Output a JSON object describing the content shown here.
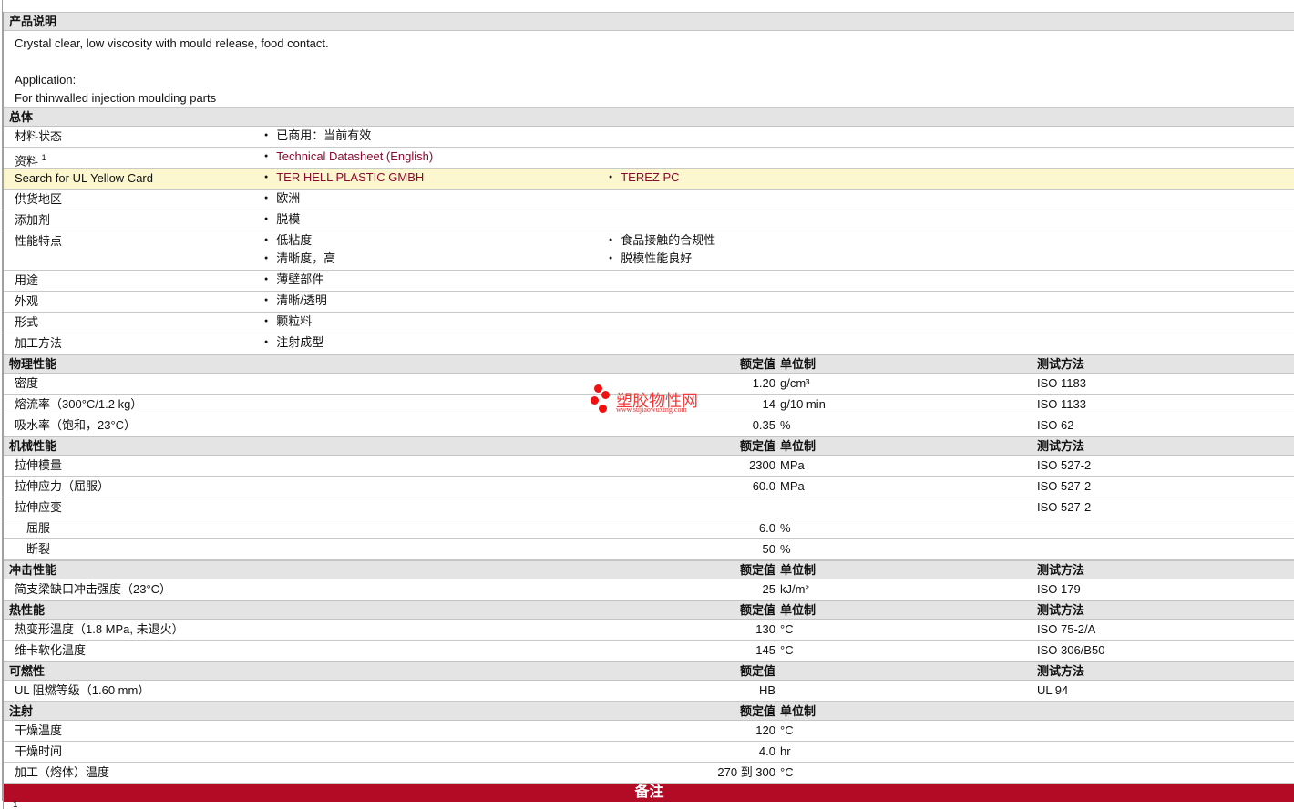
{
  "description": {
    "title": "产品说明",
    "lines": [
      "Crystal clear, low viscosity with mould release, food contact.",
      "",
      "Application:",
      "For thinwalled injection moulding parts"
    ]
  },
  "general": {
    "title": "总体",
    "rows": [
      {
        "label": "材料状态",
        "col1": [
          "已商用：当前有效"
        ],
        "col2": []
      },
      {
        "label": "资料",
        "sup": "1",
        "col1": [
          "Technical Datasheet (English)"
        ],
        "col2": [],
        "link": true
      },
      {
        "label": "Search for UL Yellow Card",
        "col1": [
          "TER HELL PLASTIC GMBH"
        ],
        "col2": [
          "TEREZ PC"
        ],
        "link": true,
        "highlight": true
      },
      {
        "label": "供货地区",
        "col1": [
          "欧洲"
        ],
        "col2": []
      },
      {
        "label": "添加剂",
        "col1": [
          "脱模"
        ],
        "col2": []
      },
      {
        "label": "性能特点",
        "col1": [
          "低粘度",
          "清晰度，高"
        ],
        "col2": [
          "食品接触的合规性",
          "脱模性能良好"
        ]
      },
      {
        "label": "用途",
        "col1": [
          "薄壁部件"
        ],
        "col2": []
      },
      {
        "label": "外观",
        "col1": [
          "清晰/透明"
        ],
        "col2": []
      },
      {
        "label": "形式",
        "col1": [
          "颗粒料"
        ],
        "col2": []
      },
      {
        "label": "加工方法",
        "col1": [
          "注射成型"
        ],
        "col2": []
      }
    ]
  },
  "sections": [
    {
      "title": "物理性能",
      "hv": "额定值",
      "hu": "单位制",
      "hm": "测试方法",
      "rows": [
        {
          "label": "密度",
          "value": "1.20",
          "unit": "g/cm³",
          "method": "ISO 1183"
        },
        {
          "label": "熔流率（300°C/1.2 kg）",
          "value": "14",
          "unit": "g/10 min",
          "method": "ISO 1133"
        },
        {
          "label": "吸水率（饱和，23°C）",
          "value": "0.35",
          "unit": "%",
          "method": "ISO 62"
        }
      ]
    },
    {
      "title": "机械性能",
      "hv": "额定值",
      "hu": "单位制",
      "hm": "测试方法",
      "rows": [
        {
          "label": "拉伸模量",
          "value": "2300",
          "unit": "MPa",
          "method": "ISO 527-2"
        },
        {
          "label": "拉伸应力（屈服）",
          "value": "60.0",
          "unit": "MPa",
          "method": "ISO 527-2"
        },
        {
          "label": "拉伸应变",
          "value": "",
          "unit": "",
          "method": "ISO 527-2"
        },
        {
          "label": "屈服",
          "value": "6.0",
          "unit": "%",
          "method": "",
          "sub": true
        },
        {
          "label": "断裂",
          "value": "50",
          "unit": "%",
          "method": "",
          "sub": true
        }
      ]
    },
    {
      "title": "冲击性能",
      "hv": "额定值",
      "hu": "单位制",
      "hm": "测试方法",
      "rows": [
        {
          "label": "简支梁缺口冲击强度（23°C）",
          "value": "25",
          "unit": "kJ/m²",
          "method": "ISO 179"
        }
      ]
    },
    {
      "title": "热性能",
      "hv": "额定值",
      "hu": "单位制",
      "hm": "测试方法",
      "rows": [
        {
          "label": "热变形温度（1.8 MPa, 未退火）",
          "value": "130",
          "unit": "°C",
          "method": "ISO 75-2/A"
        },
        {
          "label": "维卡软化温度",
          "value": "145",
          "unit": "°C",
          "method": "ISO 306/B50"
        }
      ]
    },
    {
      "title": "可燃性",
      "hv": "额定值",
      "hu": "",
      "hm": "测试方法",
      "rows": [
        {
          "label": "UL 阻燃等级（1.60 mm）",
          "value": "HB",
          "unit": "",
          "method": "UL 94"
        }
      ]
    },
    {
      "title": "注射",
      "hv": "额定值",
      "hu": "单位制",
      "hm": "",
      "rows": [
        {
          "label": "干燥温度",
          "value": "120",
          "unit": "°C",
          "method": ""
        },
        {
          "label": "干燥时间",
          "value": "4.0",
          "unit": "hr",
          "method": ""
        },
        {
          "label": "加工（熔体）温度",
          "value": "270 到  300",
          "unit": "°C",
          "method": ""
        }
      ]
    }
  ],
  "notes": {
    "title": "备注",
    "footnote": "1"
  },
  "watermark": {
    "text": "塑胶物性网",
    "url": "www.sujiaowuxing.com"
  },
  "colors": {
    "banner": "#b30a25",
    "link": "#8b0a2f",
    "highlight": "#fdf7cf"
  }
}
